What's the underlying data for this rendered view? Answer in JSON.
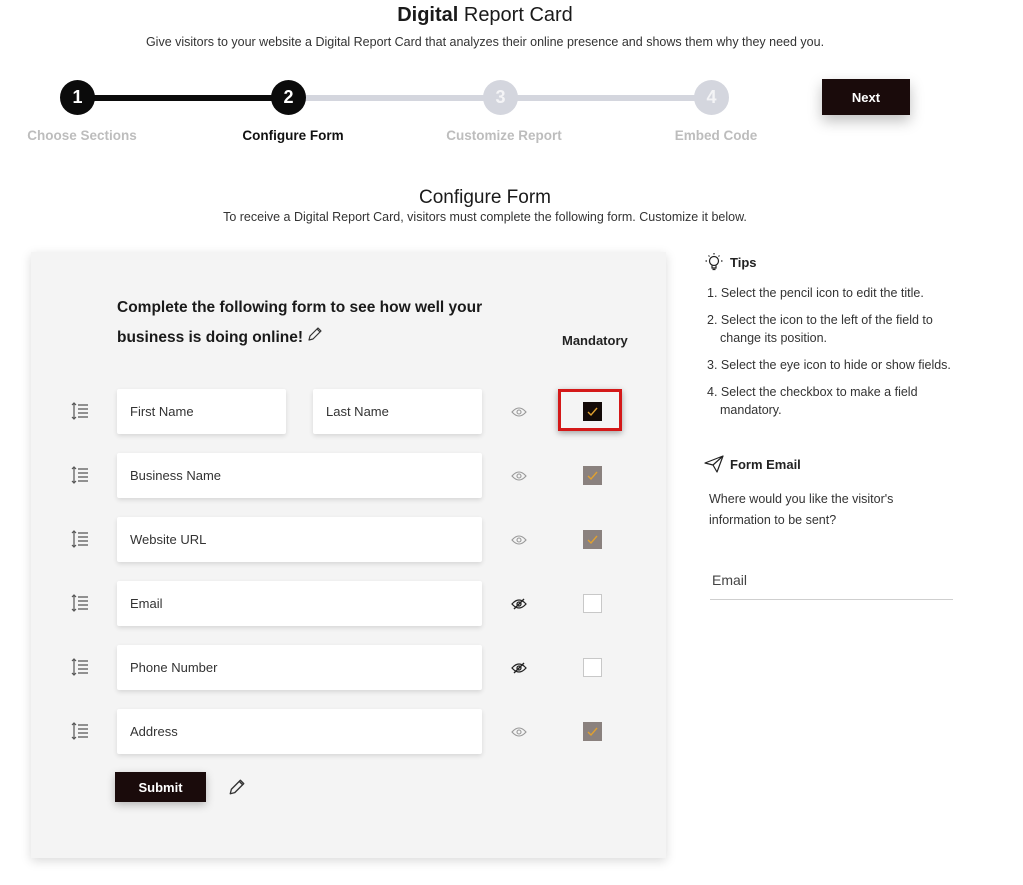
{
  "header": {
    "title_bold": "Digital",
    "title_rest": " Report Card",
    "subtitle": "Give visitors to your website a Digital Report Card that analyzes their online presence and shows them why they need you."
  },
  "stepper": {
    "steps": [
      {
        "number": "1",
        "label": "Choose Sections",
        "status": "done"
      },
      {
        "number": "2",
        "label": "Configure Form",
        "status": "active"
      },
      {
        "number": "3",
        "label": "Customize Report",
        "status": "todo"
      },
      {
        "number": "4",
        "label": "Embed Code",
        "status": "todo"
      }
    ],
    "next_label": "Next"
  },
  "section": {
    "title": "Configure Form",
    "subtitle": "To receive a Digital Report Card, visitors must complete the following form. Customize it below."
  },
  "form": {
    "heading": "Complete the following form to see how well your business is doing online!",
    "mandatory_label": "Mandatory",
    "rows": [
      {
        "fields": [
          "First Name",
          "Last Name"
        ],
        "visible": true,
        "mandatory": true,
        "highlighted": true
      },
      {
        "fields": [
          "Business Name"
        ],
        "visible": true,
        "mandatory": true,
        "highlighted": false
      },
      {
        "fields": [
          "Website URL"
        ],
        "visible": true,
        "mandatory": true,
        "highlighted": false
      },
      {
        "fields": [
          "Email"
        ],
        "visible": false,
        "mandatory": false,
        "highlighted": false
      },
      {
        "fields": [
          "Phone Number"
        ],
        "visible": false,
        "mandatory": false,
        "highlighted": false
      },
      {
        "fields": [
          "Address"
        ],
        "visible": true,
        "mandatory": true,
        "highlighted": false
      }
    ],
    "submit_label": "Submit"
  },
  "tips": {
    "title": "Tips",
    "items": [
      "1. Select the pencil icon to edit the title.",
      "2. Select the icon to the left of the field to change its position.",
      "3. Select the eye icon to hide or show fields.",
      "4. Select the checkbox to make a field mandatory."
    ]
  },
  "form_email": {
    "title": "Form Email",
    "description": "Where would you like the visitor's information to be sent?",
    "placeholder": "Email"
  },
  "colors": {
    "primary": "#1a0b0b",
    "step_inactive": "#d4d6de",
    "checkbox_checked": "#8a817e",
    "check_mark": "#e0a030",
    "highlight": "#d41818"
  }
}
